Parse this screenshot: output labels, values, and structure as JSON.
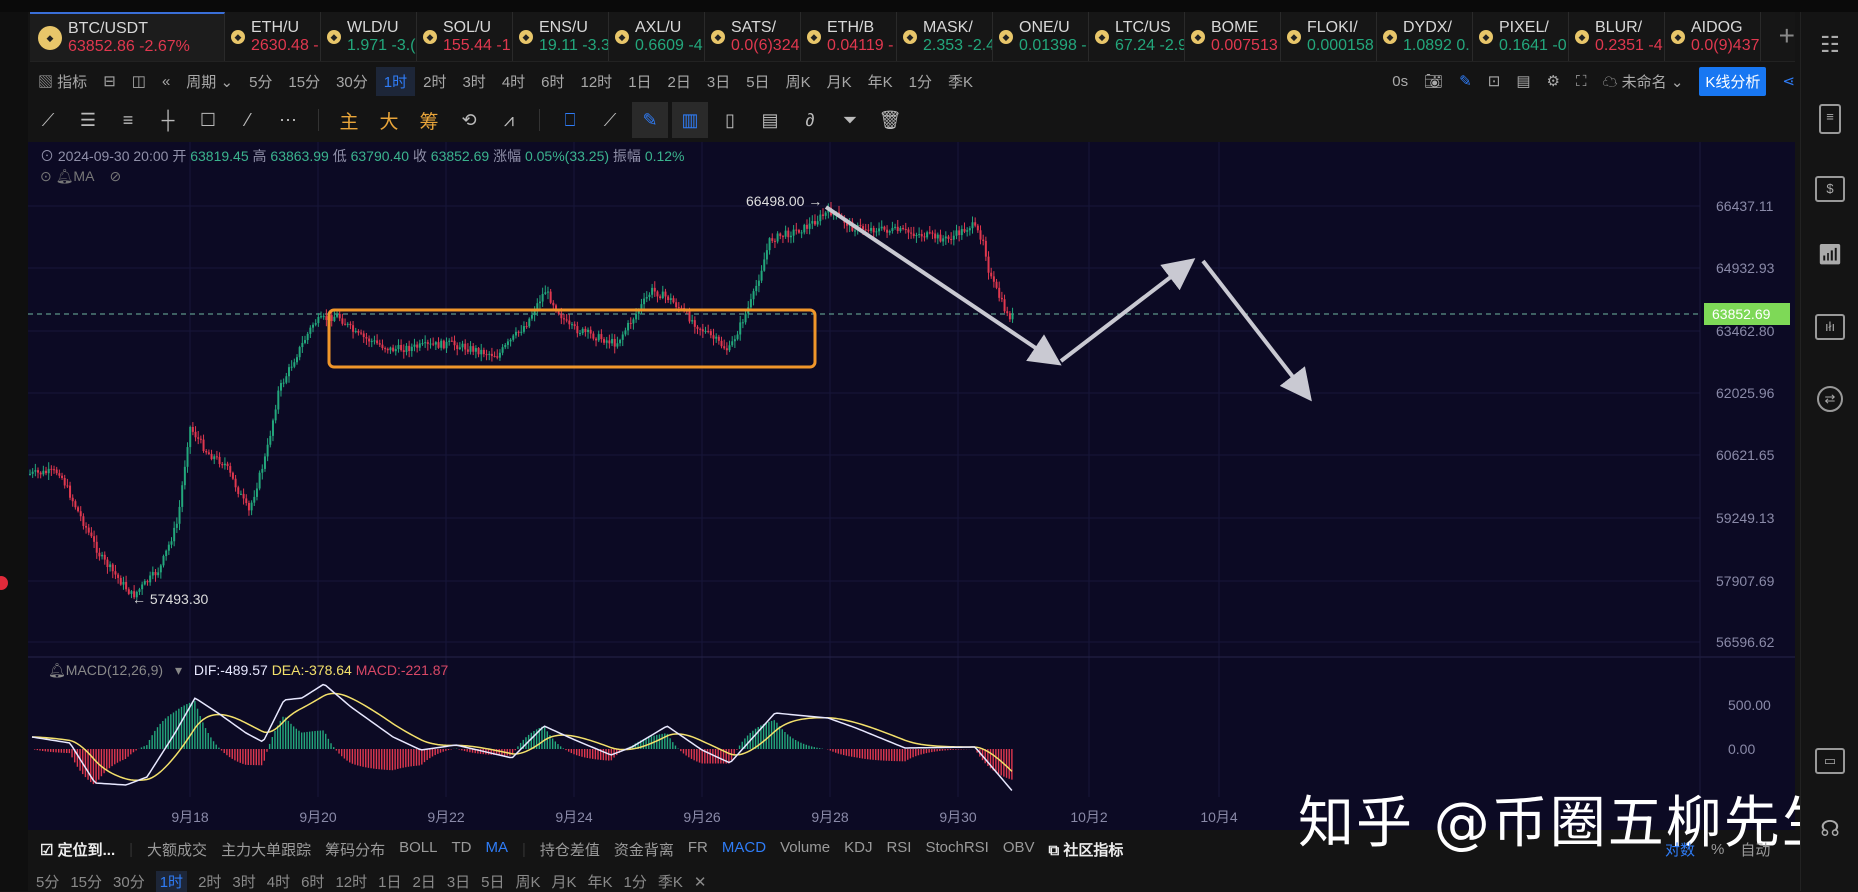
{
  "tabs": [
    {
      "name": "BTC/USDT",
      "price": "63852.86 -2.67%",
      "color": "red",
      "active": true
    },
    {
      "name": "ETH/U",
      "price": "2630.48 -",
      "color": "red"
    },
    {
      "name": "WLD/U",
      "price": "1.971 -3.(",
      "color": "green"
    },
    {
      "name": "SOL/U",
      "price": "155.44 -1",
      "color": "red"
    },
    {
      "name": "ENS/U",
      "price": "19.11 -3.3",
      "color": "green"
    },
    {
      "name": "AXL/U",
      "price": "0.6609 -4",
      "color": "green"
    },
    {
      "name": "SATS/",
      "price": "0.0(6)324",
      "color": "red"
    },
    {
      "name": "ETH/B",
      "price": "0.04119 -",
      "color": "red"
    },
    {
      "name": "MASK/",
      "price": "2.353 -2.4",
      "color": "green"
    },
    {
      "name": "ONE/U",
      "price": "0.01398 -",
      "color": "green"
    },
    {
      "name": "LTC/US",
      "price": "67.24 -2.9",
      "color": "green"
    },
    {
      "name": "BOME",
      "price": "0.007513",
      "color": "red"
    },
    {
      "name": "FLOKI/",
      "price": "0.000158",
      "color": "green"
    },
    {
      "name": "DYDX/",
      "price": "1.0892 0.",
      "color": "green"
    },
    {
      "name": "PIXEL/",
      "price": "0.1641 -0",
      "color": "green"
    },
    {
      "name": "BLUR/",
      "price": "0.2351 -4",
      "color": "red"
    },
    {
      "name": "AIDOG",
      "price": "0.0(9)437",
      "color": "red"
    }
  ],
  "toolbar": {
    "indicators": "指标",
    "period": "周期",
    "intervals": [
      "5分",
      "15分",
      "30分",
      "1时",
      "2时",
      "3时",
      "4时",
      "6时",
      "12时",
      "1日",
      "2日",
      "3日",
      "5日",
      "周K",
      "月K",
      "年K",
      "1分",
      "季K"
    ],
    "selected_interval": "1时",
    "timer": "0s",
    "layout_name": "未命名",
    "analysis_button": "K线分析"
  },
  "drawing_tools": {
    "main": "主",
    "big": "大",
    "chips": "筹"
  },
  "ohlc": {
    "datetime": "2024-09-30 20:00",
    "open_label": "开",
    "open": "63819.45",
    "high_label": "高",
    "high": "63863.99",
    "low_label": "低",
    "low": "63790.40",
    "close_label": "收",
    "close": "63852.69",
    "change_label": "涨幅",
    "change": "0.05%(33.25)",
    "amplitude_label": "振幅",
    "amplitude": "0.12%"
  },
  "ma_label": "MA",
  "price_axis": [
    "66437.11",
    "64932.93",
    "63462.80",
    "62025.96",
    "60621.65",
    "59249.13",
    "57907.69",
    "56596.62"
  ],
  "current_price": "63852.69",
  "high_marker": "66498.00 →",
  "low_marker": "← 57493.30",
  "macd": {
    "label": "MACD(12,26,9)",
    "dif": "DIF:-489.57",
    "dea": "DEA:-378.64",
    "macd": "MACD:-221.87",
    "axis": [
      "500.00",
      "0.00"
    ]
  },
  "date_axis": [
    "9月18",
    "9月20",
    "9月22",
    "9月24",
    "9月26",
    "9月28",
    "9月30",
    "10月2",
    "10月4"
  ],
  "bottom_indicators": {
    "locate": "定位到...",
    "main": [
      "大额成交",
      "主力大单跟踪",
      "筹码分布",
      "BOLL",
      "TD",
      "MA"
    ],
    "sub": [
      "持仓差值",
      "资金背离",
      "FR",
      "MACD",
      "Volume",
      "KDJ",
      "RSI",
      "StochRSI",
      "OBV"
    ],
    "community": "社区指标",
    "active": [
      "MA",
      "MACD"
    ],
    "right": [
      "对数",
      "%",
      "自动"
    ]
  },
  "bottom_intervals": [
    "5分",
    "15分",
    "30分",
    "1时",
    "2时",
    "3时",
    "4时",
    "6时",
    "12时",
    "1日",
    "2日",
    "3日",
    "5日",
    "周K",
    "月K",
    "年K",
    "1分",
    "季K"
  ],
  "watermark": "知乎 @币圈五柳先生",
  "colors": {
    "up": "#23a77c",
    "down": "#e0384f",
    "accent": "#2f7cf6",
    "box": "#f0962a",
    "price_tag": "#7ed957"
  }
}
